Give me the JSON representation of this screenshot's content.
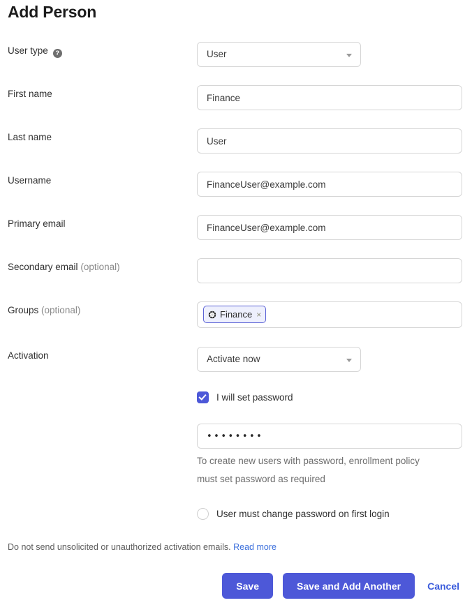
{
  "page": {
    "title": "Add Person"
  },
  "fields": {
    "user_type": {
      "label": "User type",
      "help_icon": "help-circle-icon",
      "help_glyph": "?",
      "value": "User",
      "placeholder": "User"
    },
    "first_name": {
      "label": "First name",
      "value": "Finance",
      "placeholder": "First name"
    },
    "last_name": {
      "label": "Last name",
      "value": "User",
      "placeholder": "Last name"
    },
    "username": {
      "label": "Username",
      "value": "FinanceUser@example.com",
      "placeholder": "Username"
    },
    "primary_email": {
      "label": "Primary email",
      "value": "FinanceUser@example.com",
      "placeholder": "Primary email"
    },
    "secondary_email": {
      "label": "Secondary email",
      "label_optional": "(optional)",
      "value": "",
      "placeholder": ""
    },
    "groups": {
      "label": "Groups",
      "label_optional": "(optional)",
      "chip_label": "Finance",
      "chip_icon": "group-gear-icon",
      "chip_remove": "×",
      "placeholder": ""
    },
    "activation": {
      "label": "Activation",
      "value": "Activate now",
      "placeholder": "Activate now"
    },
    "password": {
      "value": "••••••••",
      "placeholder": "Password",
      "helper_line_1": "To create new users with password, enrollment policy",
      "helper_line_2": "must set password as required"
    }
  },
  "checkboxes": {
    "set_password": {
      "label": "I will set password",
      "checked": true
    },
    "change_on_first_login": {
      "label": "User must change password on first login",
      "checked": false
    }
  },
  "footer": {
    "note": "Do not send unsolicited or unauthorized activation emails.",
    "link": "Read more"
  },
  "actions": {
    "save": "Save",
    "save_and_add": "Save and Add Another",
    "cancel": "Cancel"
  },
  "colors": {
    "accent": "#4d58d8",
    "link": "#3b5cdc",
    "border": "#d6d6d6",
    "chip_bg": "#eef0fd",
    "chip_border": "#5b62d6"
  }
}
